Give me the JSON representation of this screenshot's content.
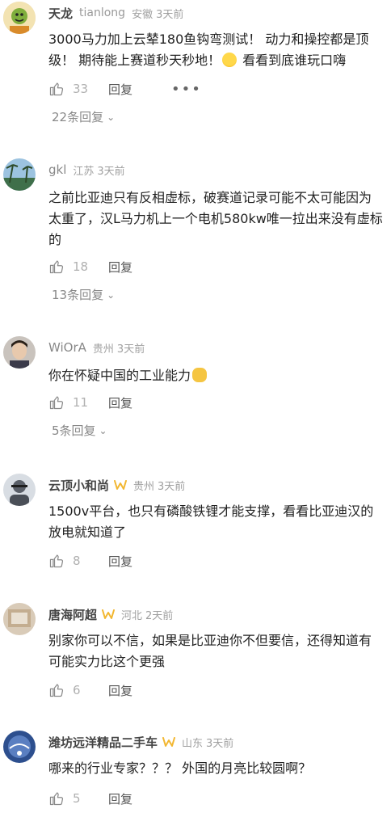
{
  "comments": [
    {
      "username": "天龙",
      "alt_name": "tianlong",
      "location": "安徽",
      "time": "3天前",
      "text_a": "3000马力加上云辇180鱼钩弯测试！ 动力和操控都是顶级！ 期待能上赛道秒天秒地！",
      "text_b": " 看看到底谁玩口嗨",
      "likes": "33",
      "reply_label": "回复",
      "more_label": "•••",
      "replies_label": "22条回复"
    },
    {
      "username": "gkl",
      "location": "江苏",
      "time": "3天前",
      "text": "之前比亚迪只有反相虚标，破赛道记录可能不太可能因为太重了，汉L马力机上一个电机580kw唯一拉出来没有虚标的",
      "likes": "18",
      "reply_label": "回复",
      "replies_label": "13条回复"
    },
    {
      "username": "WiOrA",
      "location": "贵州",
      "time": "3天前",
      "text": "你在怀疑中国的工业能力",
      "likes": "11",
      "reply_label": "回复",
      "replies_label": "5条回复"
    },
    {
      "username": "云顶小和尚",
      "location": "贵州",
      "time": "3天前",
      "text": "1500v平台，也只有磷酸铁锂才能支撑，看看比亚迪汉的放电就知道了",
      "likes": "8",
      "reply_label": "回复"
    },
    {
      "username": "唐海阿超",
      "location": "河北",
      "time": "2天前",
      "text": "别家你可以不信，如果是比亚迪你不但要信，还得知道有可能实力比这个更强",
      "likes": "6",
      "reply_label": "回复"
    },
    {
      "username": "潍坊远洋精品二手车",
      "location": "山东",
      "time": "3天前",
      "text": "哪来的行业专家？？？ 外国的月亮比较圆啊？",
      "likes": "5",
      "reply_label": "回复"
    }
  ],
  "colors": {
    "text": "#222222",
    "meta": "#a0a0a0",
    "badge": "#f2b731"
  }
}
